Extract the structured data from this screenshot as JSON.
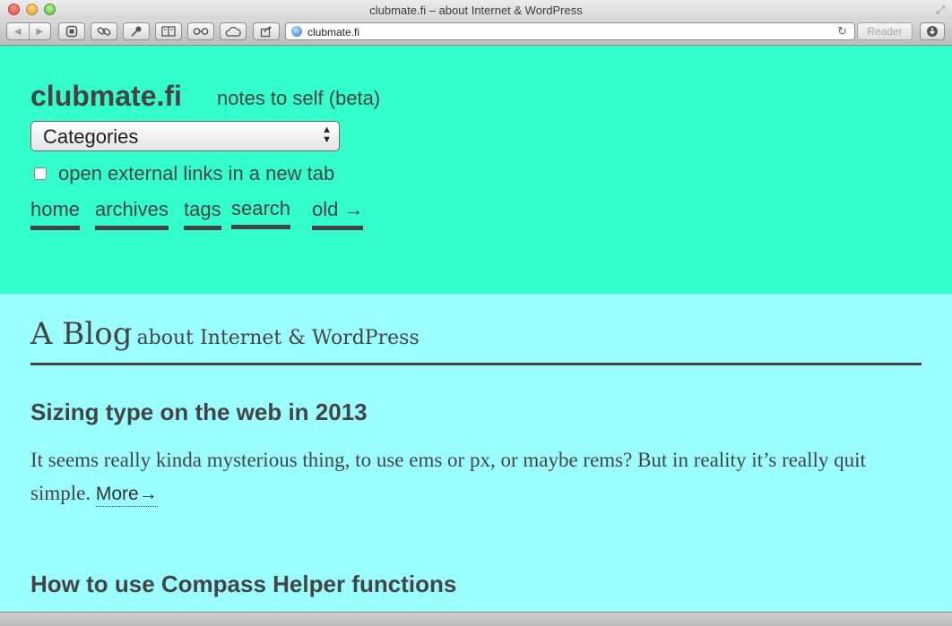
{
  "window": {
    "title": "clubmate.fi – about Internet & WordPress"
  },
  "toolbar": {
    "back_icon": "◀",
    "forward_icon": "▶",
    "url": "clubmate.fi",
    "reader_label": "Reader",
    "icons": [
      "top-sites-icon",
      "link-icon",
      "pin-icon",
      "bookmarks-icon",
      "reading-list-icon",
      "cloud-icon",
      "share-icon",
      "reload-icon",
      "downloads-icon"
    ]
  },
  "header": {
    "site_title": "clubmate.fi",
    "tagline": "notes to self (beta)",
    "categories_select": "Categories",
    "checkbox_label": "open external links in a new tab",
    "nav": [
      "home",
      "archives",
      "tags",
      "search",
      "old →"
    ]
  },
  "content": {
    "heading_big": "A Blog",
    "heading_small": "about Internet & WordPress",
    "posts": [
      {
        "title": "Sizing type on the web in 2013",
        "excerpt": "It seems really kinda mysterious thing, to use ems or px, or maybe rems? But in reality it’s really quit simple.",
        "more": "More→"
      },
      {
        "title": "How to use Compass Helper functions"
      }
    ]
  },
  "colors": {
    "header_bg": "#33ffcc",
    "content_bg": "#9afffe",
    "text": "#444444"
  }
}
